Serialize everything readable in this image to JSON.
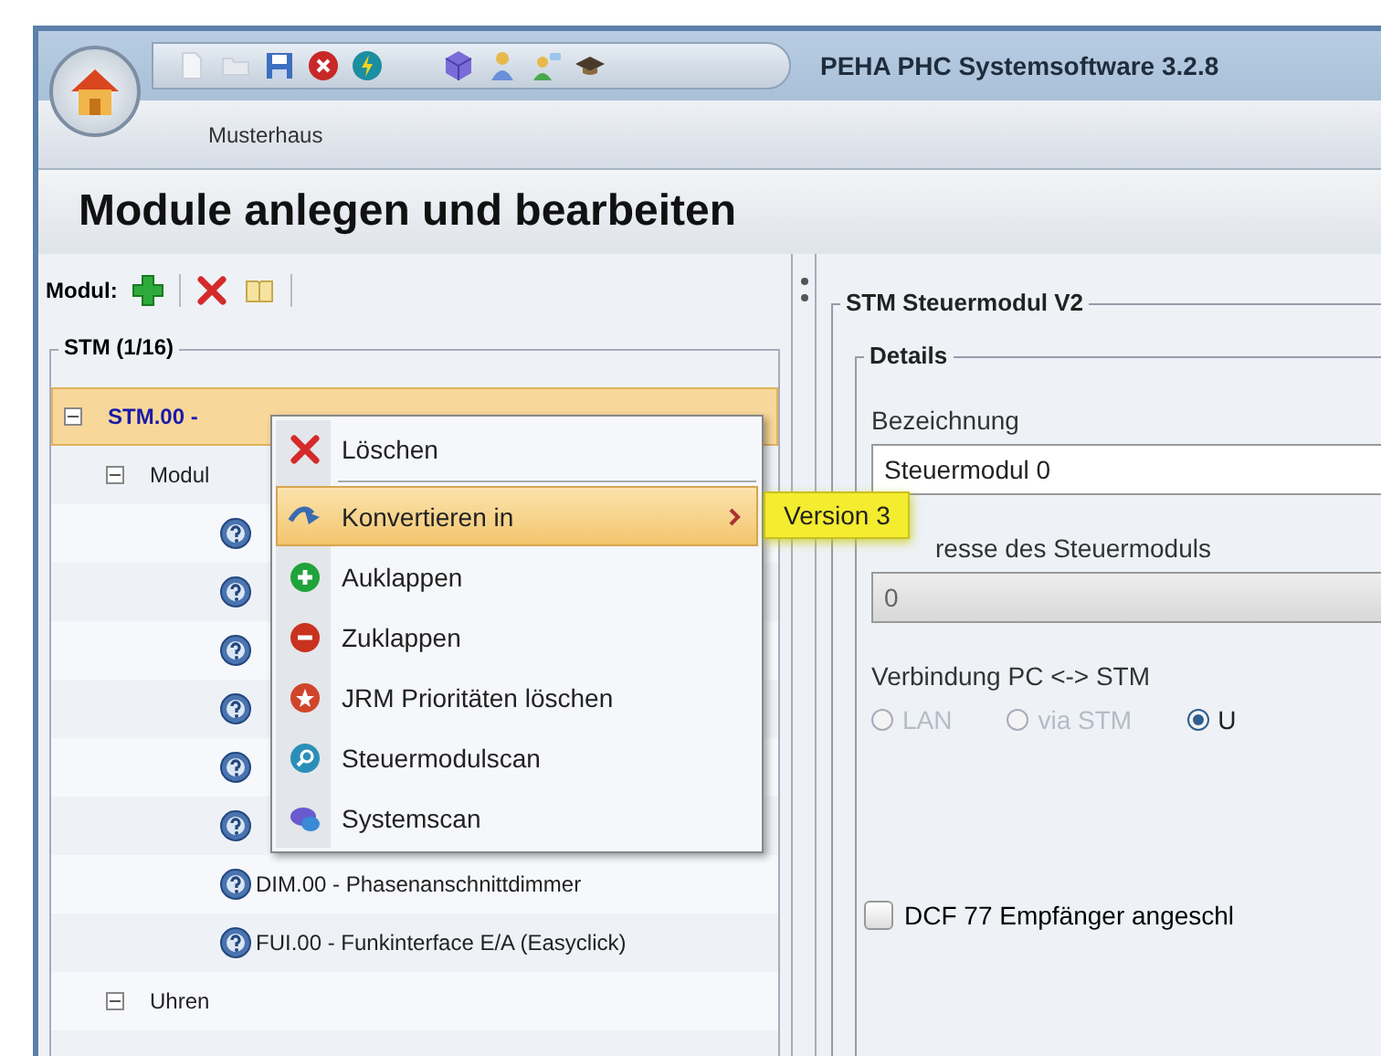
{
  "app": {
    "title": "PEHA PHC Systemsoftware 3.2.8",
    "project": "Musterhaus"
  },
  "page_title": "Module anlegen und bearbeiten",
  "module_toolbar": {
    "label": "Modul:"
  },
  "group": {
    "title": "STM (1/16)",
    "tree": [
      {
        "label": "STM.00 -",
        "selected": true,
        "expanded": true,
        "children": [
          {
            "label": "Modul",
            "selected": false,
            "expanded": true,
            "children": [
              {
                "selected": false
              },
              {
                "selected": false
              },
              {
                "selected": false
              },
              {
                "selected": false
              },
              {
                "selected": false
              },
              {
                "selected": false
              },
              {
                "label": "DIM.00 - Phasenanschnittdimmer",
                "selected": false
              },
              {
                "label": "FUI.00 - Funkinterface E/A (Easyclick)",
                "selected": false
              }
            ]
          },
          {
            "label": "Uhren",
            "selected": false,
            "expanded": true
          }
        ]
      }
    ]
  },
  "context_menu": {
    "items": [
      {
        "label": "Löschen",
        "selected": false,
        "submenu": false,
        "separator_after": true
      },
      {
        "label": "Konvertieren in",
        "selected": true,
        "submenu": true,
        "separator_after": false
      },
      {
        "label": "Auklappen",
        "selected": false,
        "submenu": false,
        "separator_after": false
      },
      {
        "label": "Zuklappen",
        "selected": false,
        "submenu": false,
        "separator_after": false
      },
      {
        "label": "JRM Prioritäten löschen",
        "selected": false,
        "submenu": false,
        "separator_after": false
      },
      {
        "label": "Steuermodulscan",
        "selected": false,
        "submenu": false,
        "separator_after": false
      },
      {
        "label": "Systemscan",
        "selected": false,
        "submenu": false,
        "separator_after": false
      }
    ],
    "submenu": {
      "items": [
        {
          "label": "Version 3",
          "selected": true
        }
      ]
    }
  },
  "details": {
    "title": "STM Steuermodul V2",
    "section": "Details",
    "fields": [
      {
        "label": "Bezeichnung",
        "value": "Steuermodul 0",
        "disabled": false
      },
      {
        "label": "resse des Steuermoduls",
        "value": "0",
        "disabled": true
      }
    ],
    "connection": {
      "label": "Verbindung PC <-> STM",
      "options": [
        {
          "label": "LAN",
          "selected": false,
          "disabled": true
        },
        {
          "label": "via STM",
          "selected": false,
          "disabled": true
        },
        {
          "label": "U",
          "selected": true,
          "disabled": false
        }
      ]
    },
    "checkbox": {
      "label": "DCF 77 Empfänger angeschl",
      "checked": false
    }
  }
}
